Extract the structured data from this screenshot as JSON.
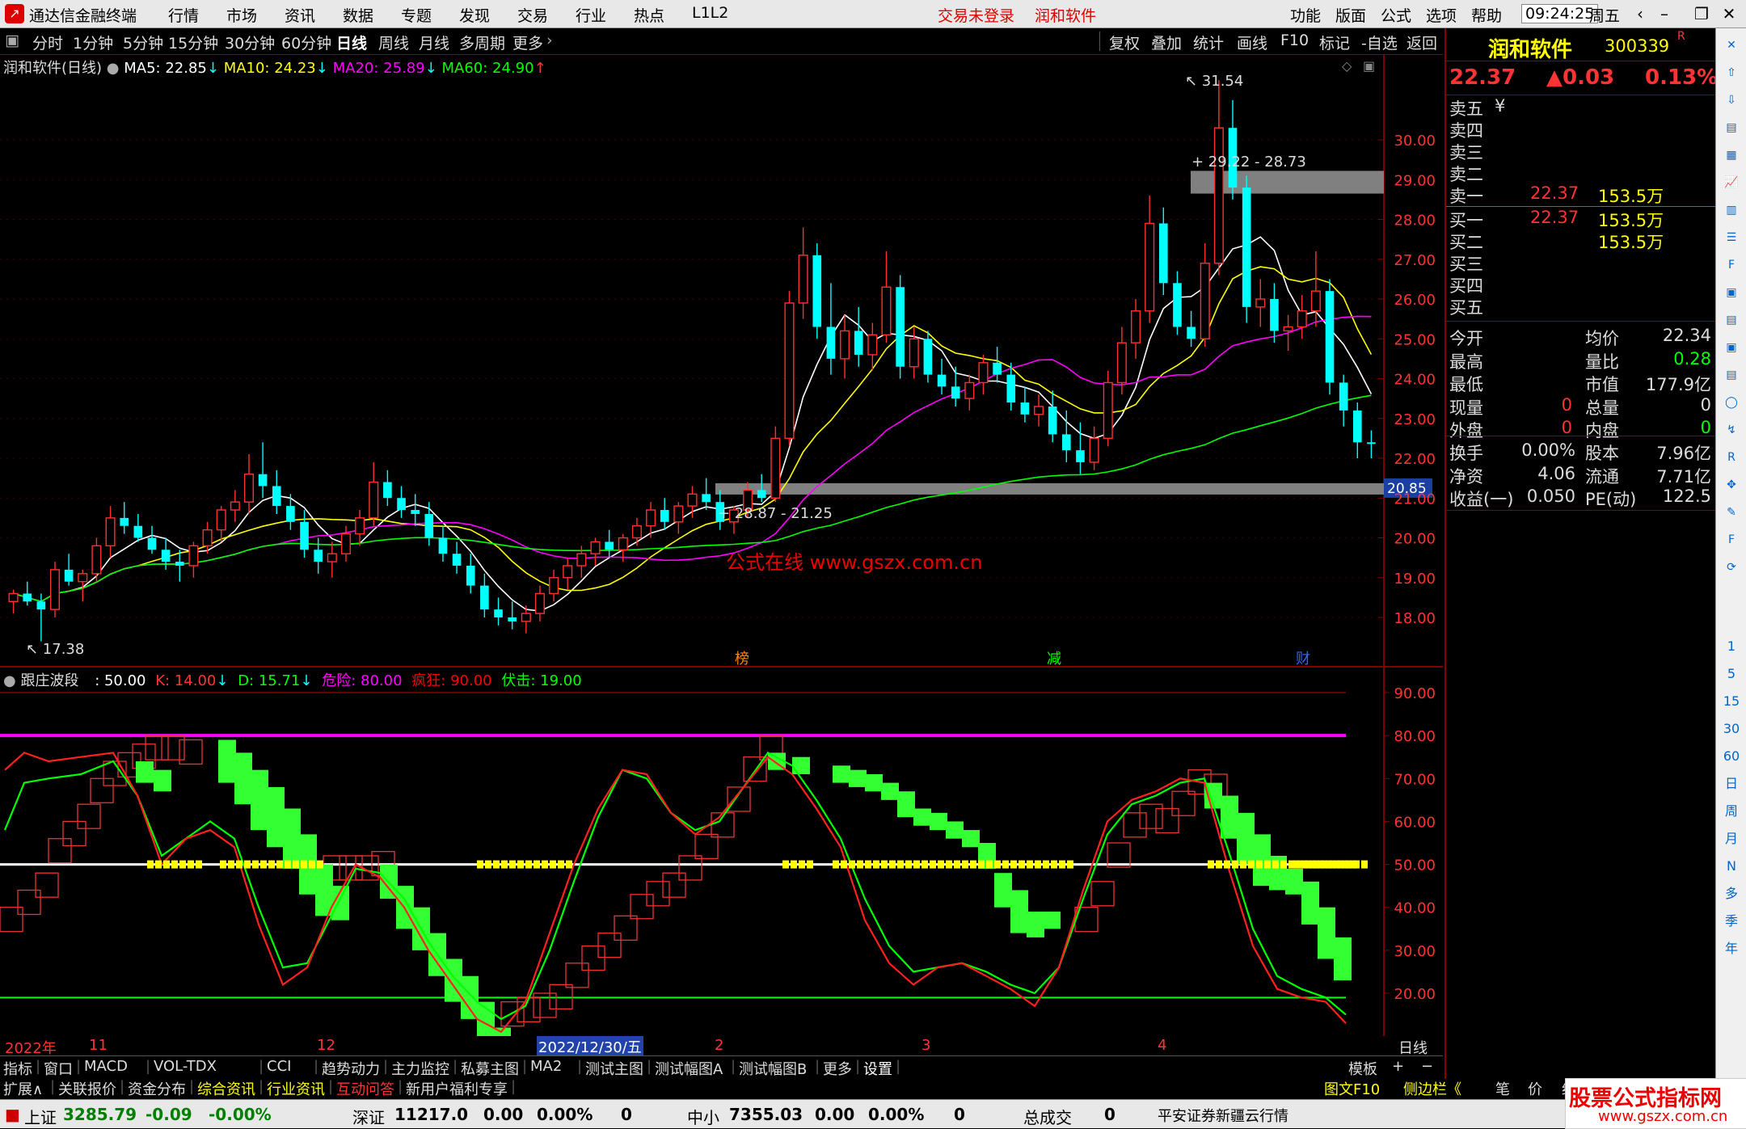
{
  "app_title": "通达信金融终端",
  "menu": [
    "行情",
    "市场",
    "资讯",
    "数据",
    "专题",
    "发现",
    "交易",
    "行业",
    "热点",
    "L1L2"
  ],
  "menu_status": [
    "交易未登录",
    "润和软件"
  ],
  "menu_right": [
    "功能",
    "版面",
    "公式",
    "选项",
    "帮助"
  ],
  "clock": "09:24:25",
  "weekday": "周五",
  "periods": [
    "分时",
    "1分钟",
    "5分钟",
    "15分钟",
    "30分钟",
    "60分钟",
    "日线",
    "周线",
    "月线",
    "多周期",
    "更多"
  ],
  "active_period": "日线",
  "chart_tools": [
    "复权",
    "叠加",
    "统计",
    "画线",
    "F10",
    "标记",
    "-自选",
    "返回"
  ],
  "stock": {
    "name": "润和软件",
    "code": "300339",
    "flag": "R",
    "price": "22.37",
    "change": "▲0.03",
    "pct": "0.13%"
  },
  "ma_legend": {
    "title": "润和软件(日线)",
    "ma5": "MA5: 22.85",
    "ma10": "MA10: 24.23",
    "ma20": "MA20: 25.89",
    "ma60": "MA60: 24.90"
  },
  "colors": {
    "up": "#ff3030",
    "down": "#00ffff",
    "ma5": "#ffffff",
    "ma10": "#ffff00",
    "ma20": "#ff00ff",
    "ma60": "#00ff00",
    "danger": "#ff00ff",
    "crazy": "#ff0000",
    "ambush": "#00ff00",
    "bg": "#000000",
    "grid": "#800000"
  },
  "price_axis": [
    "30.00",
    "29.00",
    "28.00",
    "27.00",
    "26.00",
    "25.00",
    "24.00",
    "23.00",
    "22.00",
    "21.00",
    "20.00",
    "19.00",
    "18.00"
  ],
  "indicator_axis": [
    "90.00",
    "80.00",
    "70.00",
    "60.00",
    "50.00",
    "40.00",
    "30.00",
    "20.00"
  ],
  "annotations": {
    "high": "31.54",
    "low": "17.38",
    "upper_band": "29.22 - 28.73",
    "lower_band": "28.87 - 21.25",
    "band_price": "20.85",
    "watermark": "公式在线  www.gszx.com.cn"
  },
  "event_markers": [
    "榜",
    "减",
    "财"
  ],
  "indicator": {
    "name": "跟庄波段",
    "value": ": 50.00",
    "k": "K: 14.00",
    "d": "D: 15.71",
    "danger": "危险: 80.00",
    "crazy": "疯狂: 90.00",
    "ambush": "伏击: 19.00"
  },
  "x_axis_labels": [
    "2022年",
    "11",
    "12",
    "2022/12/30/五",
    "2",
    "3",
    "4"
  ],
  "x_axis_period": "日线",
  "indicator_tabs": [
    "指标",
    "窗口",
    "MACD",
    "VOL-TDX",
    "CCI",
    "趋势动力",
    "主力监控",
    "私募主图",
    "MA2",
    "测试主图",
    "测试幅图A",
    "测试幅图B",
    "更多",
    "设置"
  ],
  "indicator_tabs_right": [
    "模板",
    "+",
    "−"
  ],
  "bottom_tabs": [
    "扩展∧",
    "关联报价",
    "资金分布",
    "综合资讯",
    "行业资讯",
    "互动问答",
    "新用户福利专享"
  ],
  "bottom_tabs_right": [
    "图文F10",
    "侧边栏《",
    "笔",
    "价",
    "细"
  ],
  "quote": {
    "asks": [
      {
        "label": "卖五",
        "price": "",
        "vol": ""
      },
      {
        "label": "卖四",
        "price": "",
        "vol": ""
      },
      {
        "label": "卖三",
        "price": "",
        "vol": ""
      },
      {
        "label": "卖二",
        "price": "",
        "vol": ""
      },
      {
        "label": "卖一",
        "price": "22.37",
        "vol": "153.5万"
      }
    ],
    "bids": [
      {
        "label": "买一",
        "price": "22.37",
        "vol": "153.5万"
      },
      {
        "label": "买二",
        "price": "",
        "vol": "153.5万"
      },
      {
        "label": "买三",
        "price": "",
        "vol": ""
      },
      {
        "label": "买四",
        "price": "",
        "vol": ""
      },
      {
        "label": "买五",
        "price": "",
        "vol": ""
      }
    ],
    "stats": [
      [
        "今开",
        "",
        "均价",
        "22.34"
      ],
      [
        "最高",
        "",
        "量比",
        "0.28"
      ],
      [
        "最低",
        "",
        "市值",
        "177.9亿"
      ],
      [
        "现量",
        "0",
        "总量",
        "0"
      ],
      [
        "外盘",
        "0",
        "内盘",
        "0"
      ]
    ],
    "fundamentals": [
      [
        "换手",
        "0.00%",
        "股本",
        "7.96亿"
      ],
      [
        "净资",
        "4.06",
        "流通",
        "7.71亿"
      ],
      [
        "收益(一)",
        "0.050",
        "PE(动)",
        "122.5"
      ]
    ]
  },
  "sidebar_labels": [
    "1",
    "5",
    "15",
    "30",
    "60",
    "日",
    "周",
    "月",
    "N",
    "多",
    "季",
    "年"
  ],
  "status": {
    "sh_name": "上证",
    "sh_val": "3285.79",
    "sh_chg": "-0.09",
    "sh_pct": "-0.00%",
    "sz_name": "深证",
    "sz_val": "11217.0",
    "sz_chg": "0.00",
    "sz_pct": "0.00%",
    "sz_x": "0",
    "zx_name": "中小",
    "zx_val": "7355.03",
    "zx_chg": "0.00",
    "zx_pct": "0.00%",
    "zx_x": "0",
    "total_name": "总成交",
    "total_val": "0",
    "broker": "平安证券新疆云行情",
    "brand": "股票公式指标网",
    "brand_url": "www.gszx.com.cn"
  },
  "chart_data": {
    "type": "candlestick",
    "price_range": [
      17.0,
      32.0
    ],
    "candles": [
      [
        18.4,
        18.7,
        18.1,
        18.6
      ],
      [
        18.6,
        18.9,
        18.3,
        18.4
      ],
      [
        18.4,
        18.6,
        17.4,
        18.2
      ],
      [
        18.2,
        19.4,
        18.0,
        19.2
      ],
      [
        19.2,
        19.6,
        18.8,
        18.9
      ],
      [
        18.9,
        19.2,
        18.4,
        19.1
      ],
      [
        19.1,
        20.0,
        18.9,
        19.8
      ],
      [
        19.8,
        20.8,
        19.5,
        20.5
      ],
      [
        20.5,
        20.9,
        20.1,
        20.3
      ],
      [
        20.3,
        20.6,
        19.9,
        20.0
      ],
      [
        20.0,
        20.3,
        19.6,
        19.7
      ],
      [
        19.7,
        20.0,
        19.2,
        19.4
      ],
      [
        19.4,
        19.7,
        18.9,
        19.3
      ],
      [
        19.3,
        19.9,
        19.0,
        19.8
      ],
      [
        19.8,
        20.4,
        19.6,
        20.2
      ],
      [
        20.2,
        20.8,
        19.9,
        20.7
      ],
      [
        20.7,
        21.2,
        20.4,
        20.9
      ],
      [
        20.9,
        22.1,
        20.6,
        21.6
      ],
      [
        21.6,
        22.4,
        21.0,
        21.3
      ],
      [
        21.3,
        21.7,
        20.6,
        20.8
      ],
      [
        20.8,
        21.1,
        20.2,
        20.4
      ],
      [
        20.4,
        20.7,
        19.5,
        19.7
      ],
      [
        19.7,
        20.0,
        19.1,
        19.4
      ],
      [
        19.4,
        19.9,
        19.0,
        19.6
      ],
      [
        19.6,
        20.3,
        19.4,
        20.1
      ],
      [
        20.1,
        20.7,
        19.8,
        20.5
      ],
      [
        20.5,
        21.9,
        20.3,
        21.4
      ],
      [
        21.4,
        21.7,
        20.8,
        21.0
      ],
      [
        21.0,
        21.3,
        20.5,
        20.7
      ],
      [
        20.7,
        21.1,
        20.3,
        20.6
      ],
      [
        20.6,
        20.9,
        19.8,
        20.0
      ],
      [
        20.0,
        20.3,
        19.4,
        19.6
      ],
      [
        19.6,
        19.9,
        19.1,
        19.3
      ],
      [
        19.3,
        19.6,
        18.6,
        18.8
      ],
      [
        18.8,
        19.1,
        18.0,
        18.2
      ],
      [
        18.2,
        18.5,
        17.8,
        18.0
      ],
      [
        18.0,
        18.4,
        17.7,
        17.9
      ],
      [
        17.9,
        18.3,
        17.6,
        18.1
      ],
      [
        18.1,
        18.8,
        17.9,
        18.6
      ],
      [
        18.6,
        19.2,
        18.4,
        19.0
      ],
      [
        19.0,
        19.5,
        18.7,
        19.3
      ],
      [
        19.3,
        19.8,
        19.0,
        19.6
      ],
      [
        19.6,
        20.0,
        19.3,
        19.9
      ],
      [
        19.9,
        20.2,
        19.5,
        19.7
      ],
      [
        19.7,
        20.1,
        19.4,
        20.0
      ],
      [
        20.0,
        20.5,
        19.8,
        20.3
      ],
      [
        20.3,
        20.9,
        20.0,
        20.7
      ],
      [
        20.7,
        21.0,
        20.2,
        20.4
      ],
      [
        20.4,
        20.9,
        20.1,
        20.8
      ],
      [
        20.8,
        21.3,
        20.5,
        21.1
      ],
      [
        21.1,
        21.5,
        20.7,
        20.9
      ],
      [
        20.9,
        21.2,
        20.2,
        20.4
      ],
      [
        20.4,
        20.8,
        20.1,
        20.7
      ],
      [
        20.7,
        21.4,
        20.5,
        21.2
      ],
      [
        21.2,
        21.6,
        20.9,
        21.0
      ],
      [
        21.0,
        22.8,
        20.9,
        22.5
      ],
      [
        22.5,
        26.2,
        22.3,
        25.9
      ],
      [
        25.9,
        27.8,
        25.5,
        27.1
      ],
      [
        27.1,
        27.4,
        25.0,
        25.3
      ],
      [
        25.3,
        26.4,
        24.1,
        24.5
      ],
      [
        24.5,
        25.6,
        24.0,
        25.2
      ],
      [
        25.2,
        25.8,
        24.3,
        24.6
      ],
      [
        24.6,
        25.4,
        24.2,
        25.1
      ],
      [
        25.1,
        27.2,
        24.9,
        26.3
      ],
      [
        26.3,
        26.6,
        24.0,
        24.3
      ],
      [
        24.3,
        25.3,
        24.0,
        25.0
      ],
      [
        25.0,
        25.2,
        23.9,
        24.1
      ],
      [
        24.1,
        24.5,
        23.6,
        23.8
      ],
      [
        23.8,
        24.3,
        23.3,
        23.5
      ],
      [
        23.5,
        24.1,
        23.2,
        23.9
      ],
      [
        23.9,
        24.6,
        23.6,
        24.4
      ],
      [
        24.4,
        24.8,
        23.9,
        24.1
      ],
      [
        24.1,
        24.4,
        23.2,
        23.4
      ],
      [
        23.4,
        23.8,
        22.9,
        23.1
      ],
      [
        23.1,
        23.6,
        22.8,
        23.3
      ],
      [
        23.3,
        23.7,
        22.4,
        22.6
      ],
      [
        22.6,
        23.2,
        21.9,
        22.2
      ],
      [
        22.2,
        22.9,
        21.6,
        21.9
      ],
      [
        21.9,
        22.8,
        21.7,
        22.5
      ],
      [
        22.5,
        24.2,
        22.3,
        23.9
      ],
      [
        23.9,
        25.3,
        23.6,
        24.9
      ],
      [
        24.9,
        26.0,
        24.5,
        25.7
      ],
      [
        25.7,
        28.6,
        25.4,
        27.9
      ],
      [
        27.9,
        28.3,
        26.1,
        26.4
      ],
      [
        26.4,
        26.7,
        25.1,
        25.3
      ],
      [
        25.3,
        25.7,
        24.8,
        25.0
      ],
      [
        25.0,
        27.4,
        24.8,
        26.9
      ],
      [
        26.9,
        31.5,
        26.6,
        30.3
      ],
      [
        30.3,
        31.0,
        28.5,
        28.8
      ],
      [
        28.8,
        29.1,
        25.4,
        25.8
      ],
      [
        25.8,
        26.5,
        25.3,
        26.0
      ],
      [
        26.0,
        26.4,
        24.9,
        25.2
      ],
      [
        25.2,
        25.6,
        24.7,
        25.3
      ],
      [
        25.3,
        26.1,
        25.0,
        25.7
      ],
      [
        25.7,
        27.2,
        25.3,
        26.2
      ],
      [
        26.2,
        26.5,
        23.6,
        23.9
      ],
      [
        23.9,
        24.1,
        22.8,
        23.2
      ],
      [
        23.2,
        23.4,
        22.0,
        22.4
      ],
      [
        22.4,
        22.7,
        22.0,
        22.37
      ]
    ]
  }
}
